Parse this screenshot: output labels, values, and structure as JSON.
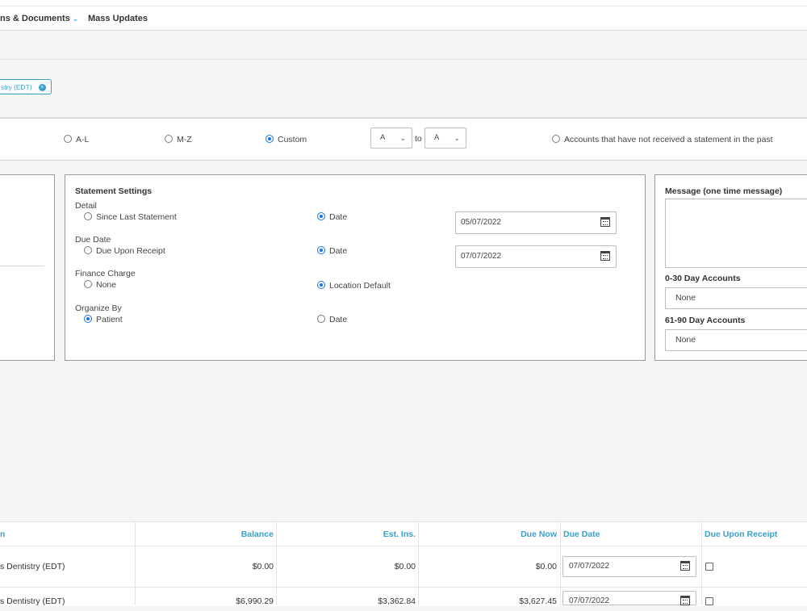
{
  "nav": {
    "items": [
      {
        "label": "ns & Documents",
        "has_dropdown": true
      },
      {
        "label": "Mass Updates",
        "has_dropdown": false
      }
    ]
  },
  "filter_chip": {
    "label": "stry (EDT)",
    "icon": "close-circle-icon"
  },
  "account_range": {
    "options": [
      {
        "label": "A-L",
        "selected": false
      },
      {
        "label": "M-Z",
        "selected": false
      },
      {
        "label": "Custom",
        "selected": true
      }
    ],
    "from_value": "A",
    "to_label": "to",
    "to_value": "A",
    "no_statement_label": "Accounts that have not received a statement in the past"
  },
  "statement_settings": {
    "title": "Statement Settings",
    "detail": {
      "label": "Detail",
      "option_a": "Since Last Statement",
      "option_b": "Date",
      "selected": "Date",
      "date_value": "05/07/2022"
    },
    "due_date": {
      "label": "Due Date",
      "option_a": "Due Upon Receipt",
      "option_b": "Date",
      "selected": "Date",
      "date_value": "07/07/2022"
    },
    "finance_charge": {
      "label": "Finance Charge",
      "option_a": "None",
      "option_b": "Location Default",
      "selected": "Location Default"
    },
    "organize_by": {
      "label": "Organize By",
      "option_a": "Patient",
      "option_b": "Date",
      "selected": "Patient"
    }
  },
  "message_panel": {
    "title": "Message (one time message)",
    "message_value": "",
    "accounts_0_30": {
      "label": "0-30 Day Accounts",
      "value": "None"
    },
    "accounts_61_90": {
      "label": "61-90 Day Accounts",
      "value": "None"
    }
  },
  "grid": {
    "columns": [
      "n",
      "Balance",
      "Est. Ins.",
      "Due Now",
      "Due Date",
      "Due Upon Receipt"
    ],
    "rows": [
      {
        "location": "s Dentistry (EDT)",
        "balance": "$0.00",
        "est_ins": "$0.00",
        "due_now": "$0.00",
        "due_date": "07/07/2022",
        "due_upon_receipt": false
      },
      {
        "location": "s Dentistry (EDT)",
        "balance": "$6,990.29",
        "est_ins": "$3,362.84",
        "due_now": "$3,627.45",
        "due_date": "07/07/2022",
        "due_upon_receipt": false
      }
    ]
  },
  "colors": {
    "accent": "#3aa0c8",
    "radio_selected": "#1a73e8",
    "panel_border": "#9a9a9a"
  }
}
